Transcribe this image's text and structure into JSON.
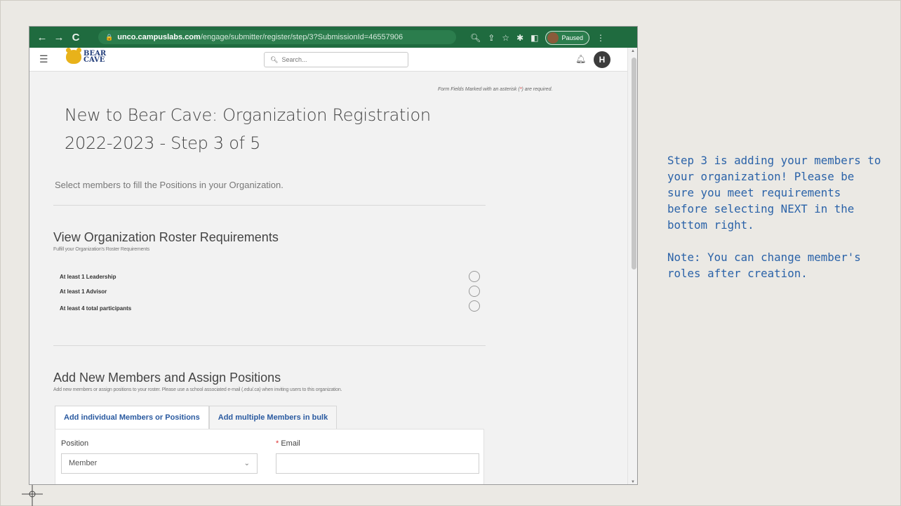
{
  "browser": {
    "back": "←",
    "forward": "→",
    "reload": "C",
    "url_host": "unco.campuslabs.com",
    "url_path": "/engage/submitter/register/step/3?SubmissionId=46557906",
    "paused_label": "Paused",
    "menu": "⋮"
  },
  "header": {
    "logo_line1": "BEAR",
    "logo_line2": "CAVE",
    "search_placeholder": "Search..."
  },
  "avatar_initial": "H",
  "form": {
    "required_note_prefix": "Form Fields Marked with an asterisk (",
    "required_note_asterisk": "*",
    "required_note_suffix": ") are required.",
    "title": "New to Bear Cave: Organization Registration 2022-2023 - Step 3 of 5",
    "subtitle": "Select members to fill the Positions in your Organization."
  },
  "roster": {
    "title": "View Organization Roster Requirements",
    "description": "Fulfill your Organization's Roster Requirements",
    "requirements": [
      "At least 1 Leadership",
      "At least 1 Advisor",
      "At least 4 total participants"
    ]
  },
  "members": {
    "title": "Add New Members and Assign Positions",
    "description": "Add new members or assign positions to your roster. Please use a school associated e-mail (.edu/.ca) when inviting users to this organization.",
    "tabs": [
      "Add individual Members or Positions",
      "Add multiple Members in bulk"
    ],
    "position_label": "Position",
    "position_value": "Member",
    "email_asterisk": "*",
    "email_label": "Email"
  },
  "side_note": "Step 3 is adding your members to your organization! Please be sure you meet requirements before selecting NEXT in the bottom right.\n\nNote: You can change member's roles after creation."
}
